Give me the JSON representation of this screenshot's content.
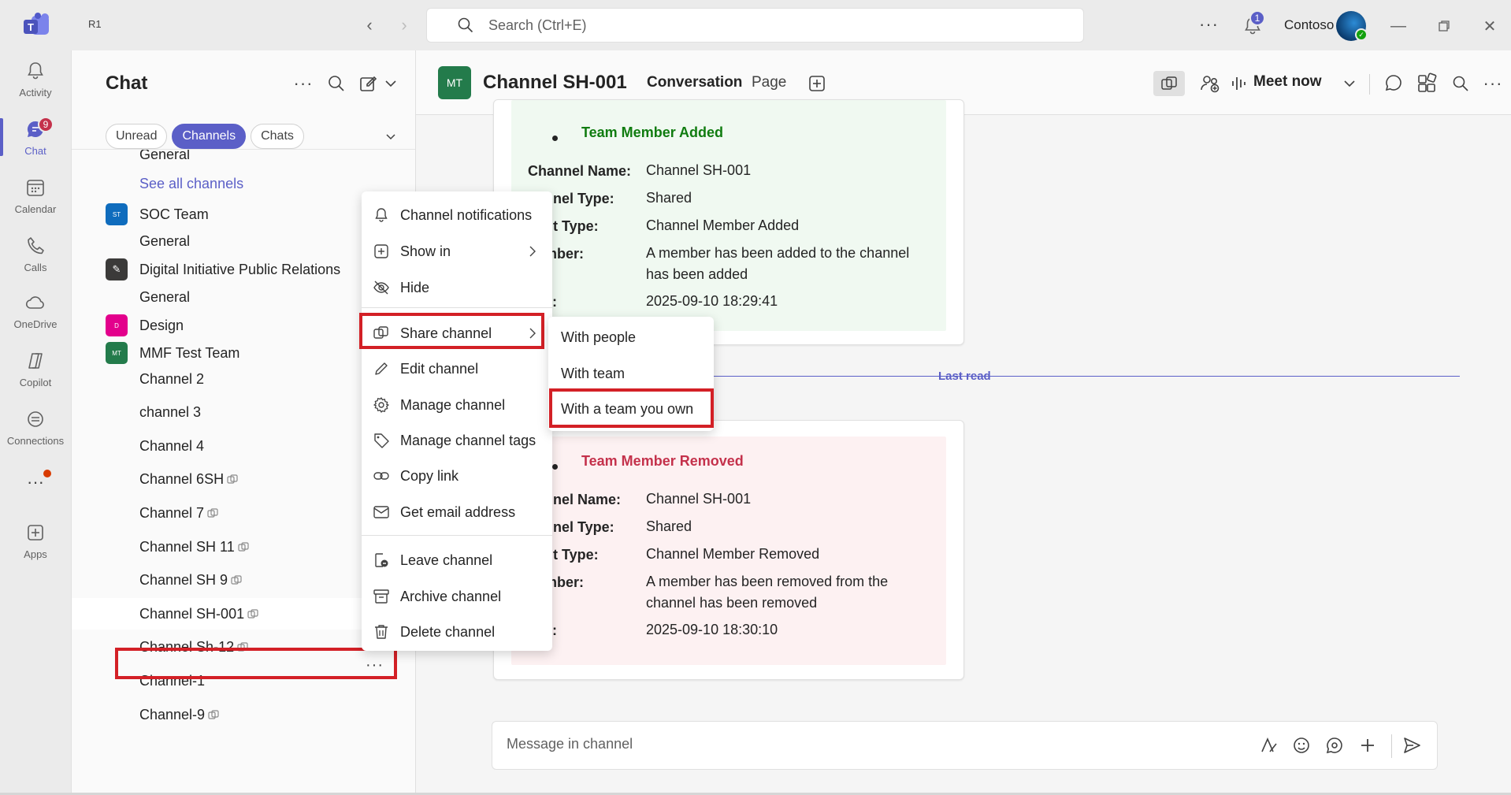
{
  "titlebar": {
    "org": "R1",
    "search_placeholder": "Search (Ctrl+E)",
    "notification_count": "1",
    "tenant": "Contoso"
  },
  "rail": {
    "items": [
      {
        "label": "Activity",
        "icon": "bell-icon"
      },
      {
        "label": "Chat",
        "icon": "chat-icon",
        "badge": "9"
      },
      {
        "label": "Calendar",
        "icon": "calendar-icon"
      },
      {
        "label": "Calls",
        "icon": "phone-icon"
      },
      {
        "label": "OneDrive",
        "icon": "cloud-icon"
      },
      {
        "label": "Copilot",
        "icon": "copilot-icon"
      },
      {
        "label": "Connections",
        "icon": "connections-icon"
      },
      {
        "label": "Apps",
        "icon": "add-app-icon"
      }
    ]
  },
  "chatpane": {
    "title": "Chat",
    "filters": [
      "Unread",
      "Channels",
      "Chats"
    ],
    "items": [
      {
        "label": "General",
        "kind": "channel"
      },
      {
        "label": "See all channels",
        "kind": "link"
      },
      {
        "label": "SOC Team",
        "kind": "team",
        "initials": "ST",
        "color": "#0f6cbd"
      },
      {
        "label": "General",
        "kind": "channel"
      },
      {
        "label": "Digital Initiative Public Relations",
        "kind": "team",
        "initials": "✎",
        "color": "#3b3a39"
      },
      {
        "label": "General",
        "kind": "channel"
      },
      {
        "label": "Design",
        "kind": "team",
        "initials": "D",
        "color": "#e3008c"
      },
      {
        "label": "MMF Test Team",
        "kind": "team",
        "initials": "MT",
        "color": "#237b4b"
      },
      {
        "label": "Channel 2",
        "kind": "channel"
      },
      {
        "label": "channel 3",
        "kind": "channel"
      },
      {
        "label": "Channel 4",
        "kind": "channel"
      },
      {
        "label": "Channel 6SH",
        "kind": "channel",
        "shared": true
      },
      {
        "label": "Channel 7",
        "kind": "channel",
        "shared": true
      },
      {
        "label": "Channel SH 11",
        "kind": "channel",
        "shared": true
      },
      {
        "label": "Channel SH 9",
        "kind": "channel",
        "shared": true
      },
      {
        "label": "Channel SH-001",
        "kind": "channel",
        "shared": true,
        "selected": true
      },
      {
        "label": "Channel Sh-12",
        "kind": "channel",
        "shared": true
      },
      {
        "label": "Channel-1",
        "kind": "channel"
      },
      {
        "label": "Channel-9",
        "kind": "channel",
        "shared": true
      }
    ]
  },
  "header": {
    "avatar_initials": "MT",
    "channel_title": "Channel SH-001",
    "tabs": [
      "Conversation",
      "Page"
    ],
    "meet_now": "Meet now"
  },
  "conversation": {
    "card1": {
      "title": "Team Member Added",
      "rows": [
        {
          "k": "Channel Name:",
          "v": "Channel SH-001"
        },
        {
          "k": "nnel Type:",
          "v": "Shared"
        },
        {
          "k": "nt Type:",
          "v": "Channel Member Added"
        },
        {
          "k": "mber:",
          "v": "A member has been added to the channel has been added"
        },
        {
          "k": "e:",
          "v": "2025-09-10 18:29:41"
        }
      ]
    },
    "last_read": "Last read",
    "card2": {
      "title": "Team Member Removed",
      "rows": [
        {
          "k": "nnel Name:",
          "v": "Channel SH-001"
        },
        {
          "k": "nnel Type:",
          "v": "Shared"
        },
        {
          "k": "nt Type:",
          "v": "Channel Member Removed"
        },
        {
          "k": "mber:",
          "v": "A member has been removed from the channel has been removed"
        },
        {
          "k": "e:",
          "v": "2025-09-10 18:30:10"
        }
      ]
    },
    "composer_placeholder": "Message in channel"
  },
  "context_menu": {
    "items": [
      {
        "label": "Channel notifications",
        "icon": "bell-icon"
      },
      {
        "label": "Show in",
        "icon": "add-square-icon",
        "submenu": true
      },
      {
        "label": "Hide",
        "icon": "eye-off-icon"
      },
      {
        "label": "Share channel",
        "icon": "share-channel-icon",
        "submenu": true
      },
      {
        "label": "Edit channel",
        "icon": "pencil-icon"
      },
      {
        "label": "Manage channel",
        "icon": "gear-icon"
      },
      {
        "label": "Manage channel tags",
        "icon": "tag-icon"
      },
      {
        "label": "Copy link",
        "icon": "link-icon"
      },
      {
        "label": "Get email address",
        "icon": "mail-icon"
      },
      {
        "label": "Leave channel",
        "icon": "leave-icon"
      },
      {
        "label": "Archive channel",
        "icon": "archive-icon"
      },
      {
        "label": "Delete channel",
        "icon": "trash-icon"
      }
    ]
  },
  "share_submenu": {
    "items": [
      "With people",
      "With team",
      "With a team you own"
    ]
  },
  "colors": {
    "brand": "#5b5fc7",
    "highlight": "#d32026",
    "added_green": "#107c10",
    "removed_red": "#c4314b"
  }
}
